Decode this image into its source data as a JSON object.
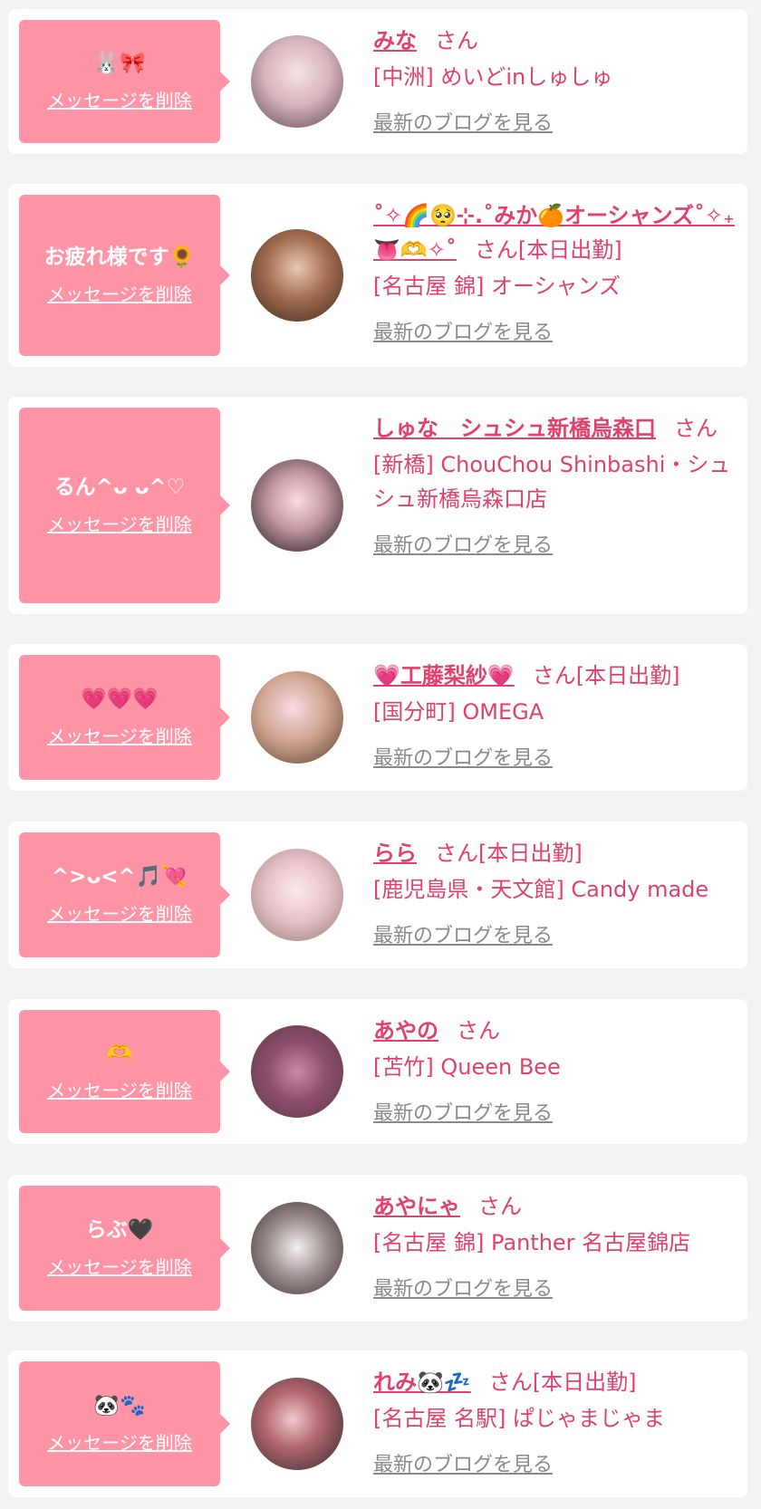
{
  "colors": {
    "accent": "#e0416d",
    "bubble": "#ff94a6",
    "link_gray": "#8a8a8a",
    "background": "#f3f3f3"
  },
  "common": {
    "delete_label": "メッセージを削除",
    "blog_label": "最新のブログを見る"
  },
  "items": [
    {
      "message": "🐰🎀",
      "name": "みな",
      "suffix": "さん",
      "shop": "[中洲] めいどinしゅしゅ"
    },
    {
      "message": "お疲れ様です🌻",
      "name": "˚✧🌈🥺⊹.˚みか🍊オーシャンズ˚✧₊👅🫶✧˚",
      "suffix": "さん[本日出勤]",
      "shop": "[名古屋 錦] オーシャンズ"
    },
    {
      "message": "るん^ᴗ ᴗ^♡",
      "name": "しゅな　シュシュ新橋烏森口",
      "suffix": "さん",
      "shop": "[新橋] ChouChou Shinbashi・シュシュ新橋烏森口店"
    },
    {
      "message": "💗💗💗",
      "name": "💗工藤梨紗💗",
      "suffix": "さん[本日出勤]",
      "shop": "[国分町] OMEGA"
    },
    {
      "message": "^>ᴗ<^🎵💘",
      "name": "らら",
      "suffix": "さん[本日出勤]",
      "shop": "[鹿児島県・天文館] Candy made"
    },
    {
      "message": "🫶",
      "name": "あやの",
      "suffix": "さん",
      "shop": "[苫竹] Queen Bee"
    },
    {
      "message": "らぶ🖤",
      "name": "あやにゃ",
      "suffix": "さん",
      "shop": "[名古屋 錦] Panther 名古屋錦店"
    },
    {
      "message": "🐼🐾",
      "name": "れみ🐼💤",
      "suffix": "さん[本日出勤]",
      "shop": "[名古屋 名駅] ぱじゃまじゃま"
    }
  ]
}
